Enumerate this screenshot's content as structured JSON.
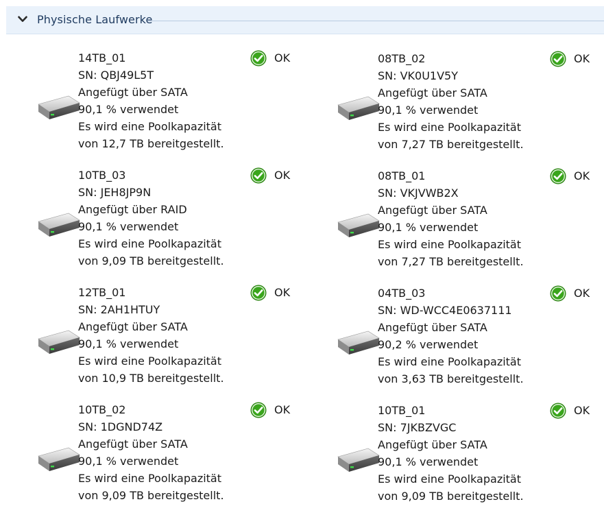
{
  "section": {
    "title": "Physische Laufwerke",
    "expander_icon": "chevron-down-icon"
  },
  "drive_icon": "hard-drive-icon",
  "status_icon": "green-check-circle-icon",
  "colors": {
    "header_background": "#eaf2fb",
    "header_text": "#1e3a5f",
    "status_ok": "#3aa51c"
  },
  "drives": [
    {
      "name": "14TB_01",
      "serial": "SN: QBJ49L5T",
      "connection": "Angefügt über SATA",
      "usage": "90,1 % verwendet",
      "capacity_line1": "Es wird eine Poolkapazität",
      "capacity_line2": "von 12,7 TB bereitgestellt.",
      "status": "OK"
    },
    {
      "name": "08TB_02",
      "serial": "SN: VK0U1V5Y",
      "connection": "Angefügt über SATA",
      "usage": "90,1 % verwendet",
      "capacity_line1": "Es wird eine Poolkapazität",
      "capacity_line2": "von 7,27 TB bereitgestellt.",
      "status": "OK"
    },
    {
      "name": "10TB_03",
      "serial": "SN: JEH8JP9N",
      "connection": "Angefügt über RAID",
      "usage": "90,1 % verwendet",
      "capacity_line1": "Es wird eine Poolkapazität",
      "capacity_line2": "von 9,09 TB bereitgestellt.",
      "status": "OK"
    },
    {
      "name": "08TB_01",
      "serial": "SN: VKJVWB2X",
      "connection": "Angefügt über SATA",
      "usage": "90,1 % verwendet",
      "capacity_line1": "Es wird eine Poolkapazität",
      "capacity_line2": "von 7,27 TB bereitgestellt.",
      "status": "OK"
    },
    {
      "name": "12TB_01",
      "serial": "SN: 2AH1HTUY",
      "connection": "Angefügt über SATA",
      "usage": "90,1 % verwendet",
      "capacity_line1": "Es wird eine Poolkapazität",
      "capacity_line2": "von 10,9 TB bereitgestellt.",
      "status": "OK"
    },
    {
      "name": "04TB_03",
      "serial": "SN: WD-WCC4E0637111",
      "connection": "Angefügt über SATA",
      "usage": "90,2 % verwendet",
      "capacity_line1": "Es wird eine Poolkapazität",
      "capacity_line2": "von 3,63 TB bereitgestellt.",
      "status": "OK"
    },
    {
      "name": "10TB_02",
      "serial": "SN: 1DGND74Z",
      "connection": "Angefügt über SATA",
      "usage": "90,1 % verwendet",
      "capacity_line1": "Es wird eine Poolkapazität",
      "capacity_line2": "von 9,09 TB bereitgestellt.",
      "status": "OK"
    },
    {
      "name": "10TB_01",
      "serial": "SN: 7JKBZVGC",
      "connection": "Angefügt über SATA",
      "usage": "90,1 % verwendet",
      "capacity_line1": "Es wird eine Poolkapazität",
      "capacity_line2": "von 9,09 TB bereitgestellt.",
      "status": "OK"
    }
  ]
}
